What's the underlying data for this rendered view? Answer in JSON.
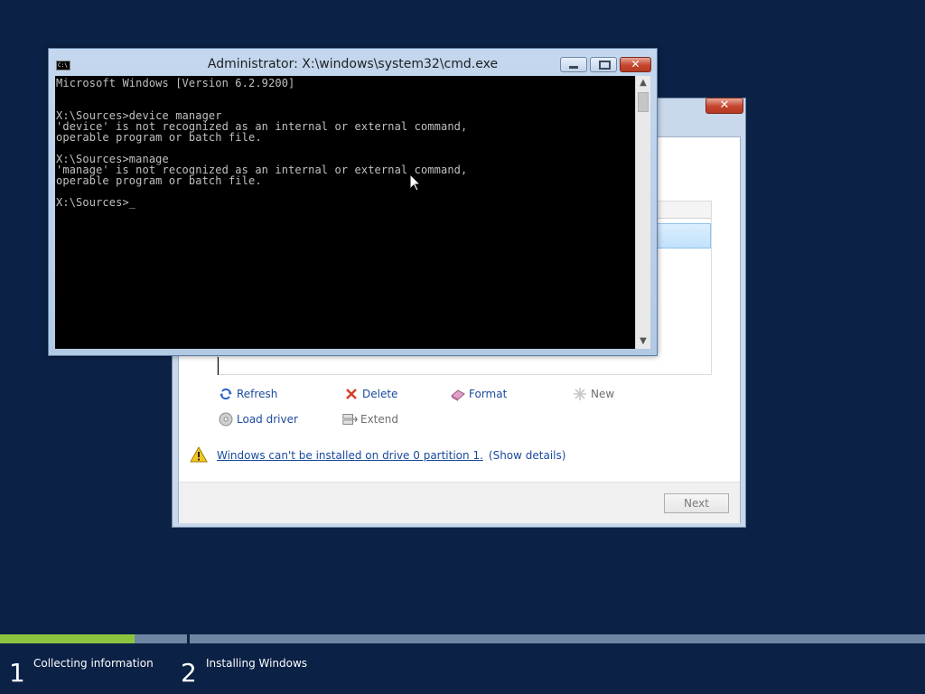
{
  "cmd_window": {
    "title": "Administrator: X:\\windows\\system32\\cmd.exe",
    "app_icon_text": "C:\\",
    "close_glyph": "✕",
    "scroll_up_glyph": "▲",
    "scroll_down_glyph": "▼",
    "console_text": "Microsoft Windows [Version 6.2.9200]\n\n\nX:\\Sources>device manager\n'device' is not recognized as an internal or external command,\noperable program or batch file.\n\nX:\\Sources>manage\n'manage' is not recognized as an internal or external command,\noperable program or batch file.\n\nX:\\Sources>_"
  },
  "setup_window": {
    "close_glyph": "✕",
    "actions": {
      "refresh": "Refresh",
      "delete": "Delete",
      "format": "Format",
      "new": "New",
      "load_driver": "Load driver",
      "extend": "Extend"
    },
    "warning_text": "Windows can't be installed on drive 0 partition 1.",
    "warning_details": "(Show details)",
    "next_label": "Next"
  },
  "progress": {
    "step1_fraction": 0.72,
    "steps": [
      {
        "number": "1",
        "label": "Collecting information"
      },
      {
        "number": "2",
        "label": "Installing Windows"
      }
    ]
  },
  "colors": {
    "desktop": "#0b2146",
    "progress_fill": "#8bc53f",
    "progress_track": "#6f86a3",
    "link": "#1a4a9c"
  }
}
